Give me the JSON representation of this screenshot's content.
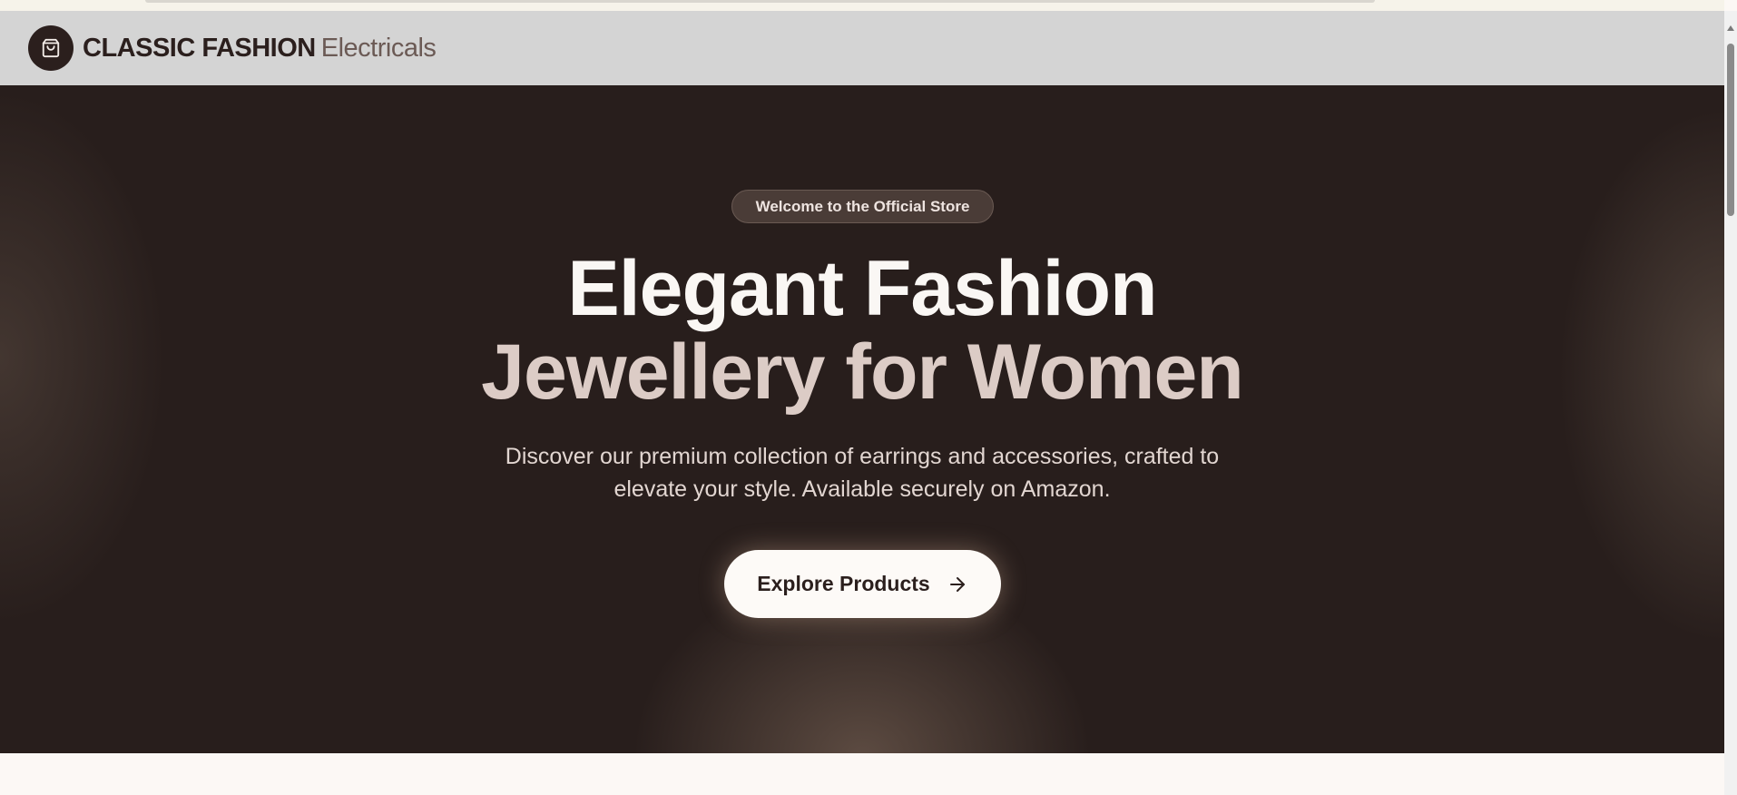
{
  "header": {
    "brand_main": "CLASSIC FASHION",
    "brand_sub": "Electricals",
    "logo_icon": "shopping-bag-icon"
  },
  "hero": {
    "badge": "Welcome to the Official Store",
    "headline_line1": "Elegant Fashion",
    "headline_line2": "Jewellery for Women",
    "description": "Discover our premium collection of earrings and accessories, crafted to elevate your style. Available securely on Amazon.",
    "cta_label": "Explore Products",
    "cta_icon": "arrow-right-icon"
  },
  "colors": {
    "nav_bg": "#d4d4d4",
    "hero_bg": "#281e1c",
    "brand_dark": "#2b1f1d",
    "accent_light": "#dcccc6"
  }
}
